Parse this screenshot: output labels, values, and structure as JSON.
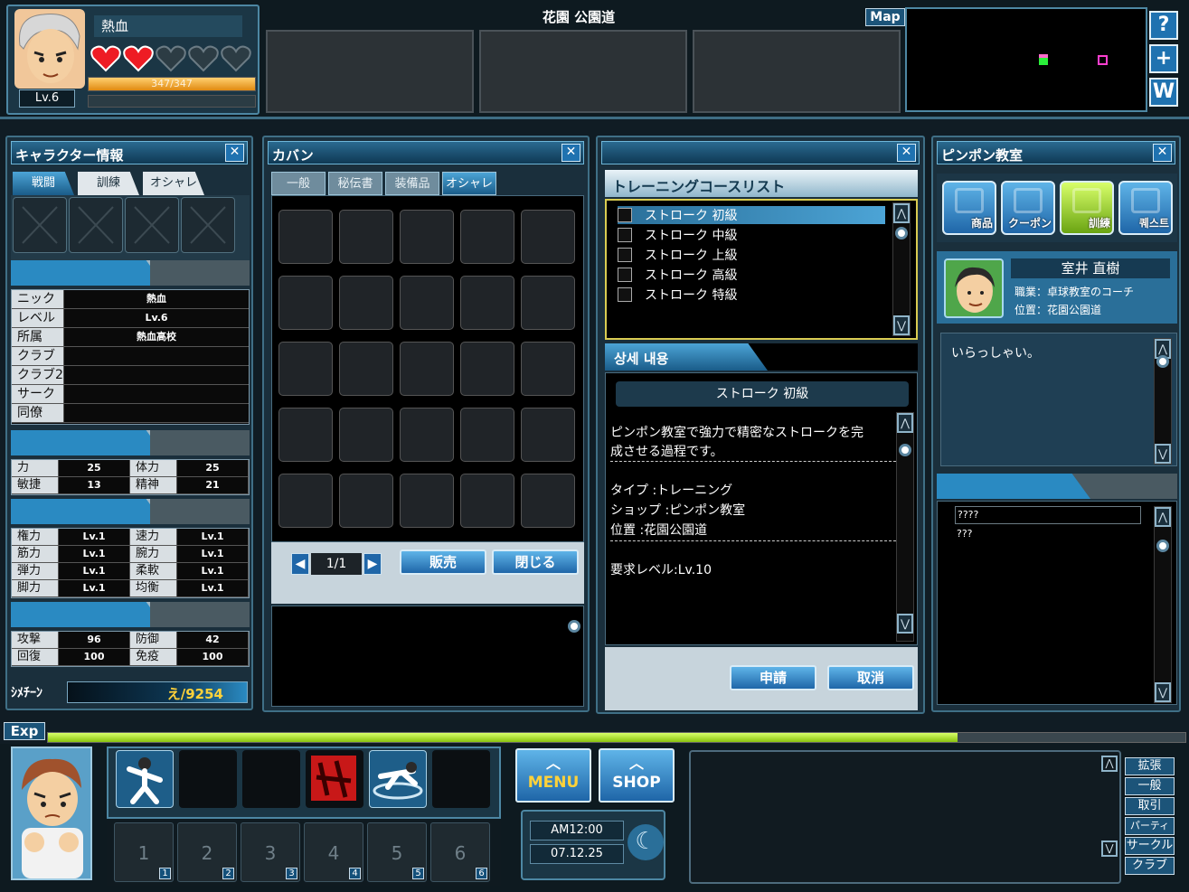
{
  "header": {
    "name": "熱血",
    "level": "Lv.6",
    "hp_text": "347/347",
    "hearts_full": 2,
    "hearts_total": 5,
    "location": "花園 公園道",
    "map_label": "Map",
    "side_buttons": [
      "?",
      "+",
      "W"
    ]
  },
  "character": {
    "title": "キャラクター情報",
    "tabs": [
      "戦闘",
      "訓練",
      "オシャレ"
    ],
    "info": [
      {
        "label": "ニック",
        "value": "熱血"
      },
      {
        "label": "レベル",
        "value": "Lv.6"
      },
      {
        "label": "所属",
        "value": "熱血高校"
      },
      {
        "label": "クラブ",
        "value": ""
      },
      {
        "label": "クラブ2",
        "value": ""
      },
      {
        "label": "サークル",
        "value": ""
      },
      {
        "label": "同僚",
        "value": ""
      }
    ],
    "base_stats": [
      {
        "l1": "力",
        "v1": "25",
        "l2": "体力",
        "v2": "25"
      },
      {
        "l1": "敏捷",
        "v1": "13",
        "l2": "精神",
        "v2": "21"
      }
    ],
    "skills": [
      {
        "l1": "権力",
        "v1": "Lv.1",
        "l2": "速力",
        "v2": "Lv.1"
      },
      {
        "l1": "筋力",
        "v1": "Lv.1",
        "l2": "腕力",
        "v2": "Lv.1"
      },
      {
        "l1": "弾力",
        "v1": "Lv.1",
        "l2": "柔軟",
        "v2": "Lv.1"
      },
      {
        "l1": "脚力",
        "v1": "Lv.1",
        "l2": "均衡",
        "v2": "Lv.1"
      }
    ],
    "combat": [
      {
        "l1": "攻撃",
        "v1": "96",
        "l2": "防御",
        "v2": "42"
      },
      {
        "l1": "回復",
        "v1": "100",
        "l2": "免疫",
        "v2": "100"
      }
    ],
    "money_label": "ｼﾒﾁｰﾝ",
    "money_value": "え/9254"
  },
  "bag": {
    "title": "カバン",
    "tabs": [
      "一般",
      "秘伝書",
      "装備品",
      "オシャレ"
    ],
    "page": "1/1",
    "sell_label": "販売",
    "close_label": "閉じる"
  },
  "training": {
    "list_title": "トレーニングコースリスト",
    "courses": [
      "ストローク 初級",
      "ストローク 中級",
      "ストローク 上級",
      "ストローク 高級",
      "ストローク 特級"
    ],
    "detail_title": "상세 내용",
    "selected_name": "ストローク 初級",
    "desc1": "ピンポン教室で強力で精密なストロークを完",
    "desc2": "成させる過程です。",
    "type": "タイプ :トレーニング",
    "shop": "ショップ :ピンポン教室",
    "location": "位置 :花園公園道",
    "req_level": "要求レベル:Lv.10",
    "apply_label": "申請",
    "cancel_label": "取消"
  },
  "pingpong": {
    "title": "ピンポン教室",
    "tabs": [
      "商品",
      "クーポン",
      "訓練",
      "퀘스트"
    ],
    "npc_name": "室井 直樹",
    "npc_job": "職業：卓球教室のコーチ",
    "npc_loc": "位置：花園公園道",
    "greeting": "いらっしゃい。",
    "q1": "????",
    "q2": "???"
  },
  "bottom": {
    "exp_label": "Exp",
    "exp_progress": 0.8,
    "menu_label": "MENU",
    "shop_label": "SHOP",
    "time": "AM12:00",
    "date": "07.12.25",
    "hotkeys": [
      "1",
      "2",
      "3",
      "4",
      "5",
      "6"
    ],
    "chat_tabs": [
      "拡張",
      "一般",
      "取引",
      "パーティー",
      "サークル",
      "クラブ"
    ]
  },
  "colors": {
    "accent": "#2a8ac2",
    "hp_bar": "#f0a020",
    "exp_bar": "#a8e020"
  }
}
